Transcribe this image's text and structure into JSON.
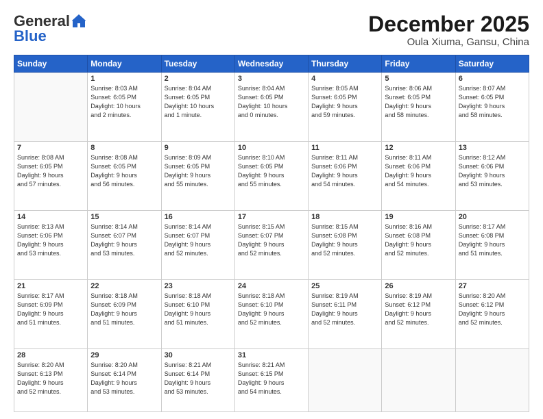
{
  "header": {
    "logo_general": "General",
    "logo_blue": "Blue",
    "month_title": "December 2025",
    "location": "Oula Xiuma, Gansu, China"
  },
  "weekdays": [
    "Sunday",
    "Monday",
    "Tuesday",
    "Wednesday",
    "Thursday",
    "Friday",
    "Saturday"
  ],
  "weeks": [
    [
      {
        "day": "",
        "info": ""
      },
      {
        "day": "1",
        "info": "Sunrise: 8:03 AM\nSunset: 6:05 PM\nDaylight: 10 hours\nand 2 minutes."
      },
      {
        "day": "2",
        "info": "Sunrise: 8:04 AM\nSunset: 6:05 PM\nDaylight: 10 hours\nand 1 minute."
      },
      {
        "day": "3",
        "info": "Sunrise: 8:04 AM\nSunset: 6:05 PM\nDaylight: 10 hours\nand 0 minutes."
      },
      {
        "day": "4",
        "info": "Sunrise: 8:05 AM\nSunset: 6:05 PM\nDaylight: 9 hours\nand 59 minutes."
      },
      {
        "day": "5",
        "info": "Sunrise: 8:06 AM\nSunset: 6:05 PM\nDaylight: 9 hours\nand 58 minutes."
      },
      {
        "day": "6",
        "info": "Sunrise: 8:07 AM\nSunset: 6:05 PM\nDaylight: 9 hours\nand 58 minutes."
      }
    ],
    [
      {
        "day": "7",
        "info": "Sunrise: 8:08 AM\nSunset: 6:05 PM\nDaylight: 9 hours\nand 57 minutes."
      },
      {
        "day": "8",
        "info": "Sunrise: 8:08 AM\nSunset: 6:05 PM\nDaylight: 9 hours\nand 56 minutes."
      },
      {
        "day": "9",
        "info": "Sunrise: 8:09 AM\nSunset: 6:05 PM\nDaylight: 9 hours\nand 55 minutes."
      },
      {
        "day": "10",
        "info": "Sunrise: 8:10 AM\nSunset: 6:05 PM\nDaylight: 9 hours\nand 55 minutes."
      },
      {
        "day": "11",
        "info": "Sunrise: 8:11 AM\nSunset: 6:06 PM\nDaylight: 9 hours\nand 54 minutes."
      },
      {
        "day": "12",
        "info": "Sunrise: 8:11 AM\nSunset: 6:06 PM\nDaylight: 9 hours\nand 54 minutes."
      },
      {
        "day": "13",
        "info": "Sunrise: 8:12 AM\nSunset: 6:06 PM\nDaylight: 9 hours\nand 53 minutes."
      }
    ],
    [
      {
        "day": "14",
        "info": "Sunrise: 8:13 AM\nSunset: 6:06 PM\nDaylight: 9 hours\nand 53 minutes."
      },
      {
        "day": "15",
        "info": "Sunrise: 8:14 AM\nSunset: 6:07 PM\nDaylight: 9 hours\nand 53 minutes."
      },
      {
        "day": "16",
        "info": "Sunrise: 8:14 AM\nSunset: 6:07 PM\nDaylight: 9 hours\nand 52 minutes."
      },
      {
        "day": "17",
        "info": "Sunrise: 8:15 AM\nSunset: 6:07 PM\nDaylight: 9 hours\nand 52 minutes."
      },
      {
        "day": "18",
        "info": "Sunrise: 8:15 AM\nSunset: 6:08 PM\nDaylight: 9 hours\nand 52 minutes."
      },
      {
        "day": "19",
        "info": "Sunrise: 8:16 AM\nSunset: 6:08 PM\nDaylight: 9 hours\nand 52 minutes."
      },
      {
        "day": "20",
        "info": "Sunrise: 8:17 AM\nSunset: 6:08 PM\nDaylight: 9 hours\nand 51 minutes."
      }
    ],
    [
      {
        "day": "21",
        "info": "Sunrise: 8:17 AM\nSunset: 6:09 PM\nDaylight: 9 hours\nand 51 minutes."
      },
      {
        "day": "22",
        "info": "Sunrise: 8:18 AM\nSunset: 6:09 PM\nDaylight: 9 hours\nand 51 minutes."
      },
      {
        "day": "23",
        "info": "Sunrise: 8:18 AM\nSunset: 6:10 PM\nDaylight: 9 hours\nand 51 minutes."
      },
      {
        "day": "24",
        "info": "Sunrise: 8:18 AM\nSunset: 6:10 PM\nDaylight: 9 hours\nand 52 minutes."
      },
      {
        "day": "25",
        "info": "Sunrise: 8:19 AM\nSunset: 6:11 PM\nDaylight: 9 hours\nand 52 minutes."
      },
      {
        "day": "26",
        "info": "Sunrise: 8:19 AM\nSunset: 6:12 PM\nDaylight: 9 hours\nand 52 minutes."
      },
      {
        "day": "27",
        "info": "Sunrise: 8:20 AM\nSunset: 6:12 PM\nDaylight: 9 hours\nand 52 minutes."
      }
    ],
    [
      {
        "day": "28",
        "info": "Sunrise: 8:20 AM\nSunset: 6:13 PM\nDaylight: 9 hours\nand 52 minutes."
      },
      {
        "day": "29",
        "info": "Sunrise: 8:20 AM\nSunset: 6:14 PM\nDaylight: 9 hours\nand 53 minutes."
      },
      {
        "day": "30",
        "info": "Sunrise: 8:21 AM\nSunset: 6:14 PM\nDaylight: 9 hours\nand 53 minutes."
      },
      {
        "day": "31",
        "info": "Sunrise: 8:21 AM\nSunset: 6:15 PM\nDaylight: 9 hours\nand 54 minutes."
      },
      {
        "day": "",
        "info": ""
      },
      {
        "day": "",
        "info": ""
      },
      {
        "day": "",
        "info": ""
      }
    ]
  ]
}
